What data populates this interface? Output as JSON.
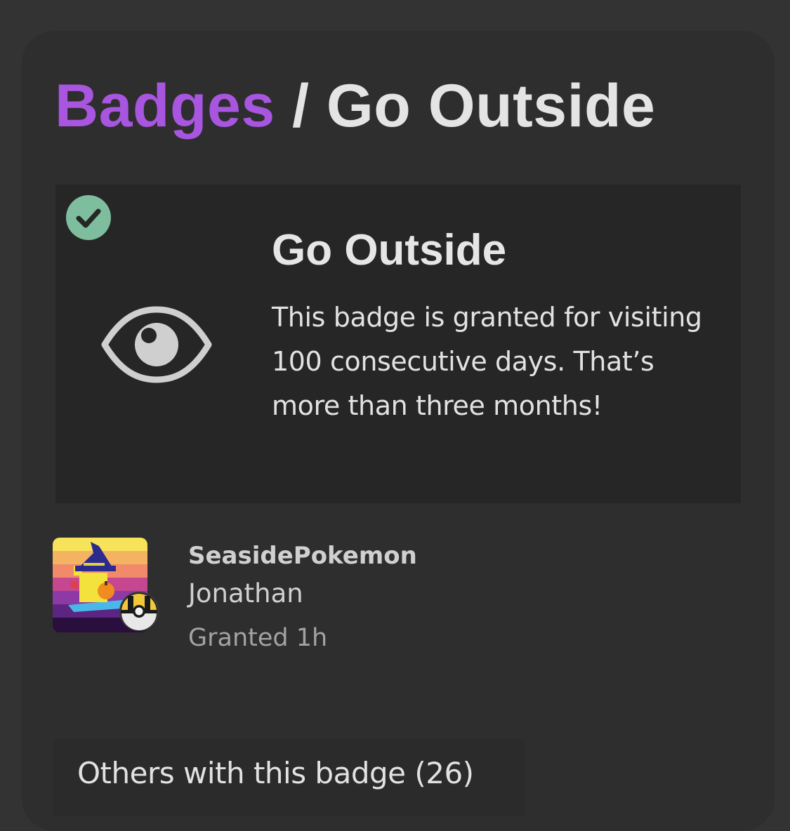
{
  "breadcrumb": {
    "parent_label": "Badges",
    "separator": "/",
    "current_label": "Go Outside"
  },
  "badge": {
    "name": "Go Outside",
    "description": "This badge is granted for visiting 100 consecutive days. That’s more than three months!",
    "icon": "eye-icon",
    "status_icon": "check-circle-icon",
    "status_color": "#7ebd9d"
  },
  "user": {
    "username": "SeasidePokemon",
    "name": "Jonathan",
    "granted": "Granted 1h",
    "avatar": "pikachu-witch-avatar",
    "avatar_flair_icon": "ultra-ball-icon"
  },
  "others": {
    "label": "Others with this badge (26)"
  },
  "colors": {
    "accent": "#a855e0",
    "background": "#333333",
    "panel": "#2e2e2e",
    "card": "#262626"
  }
}
